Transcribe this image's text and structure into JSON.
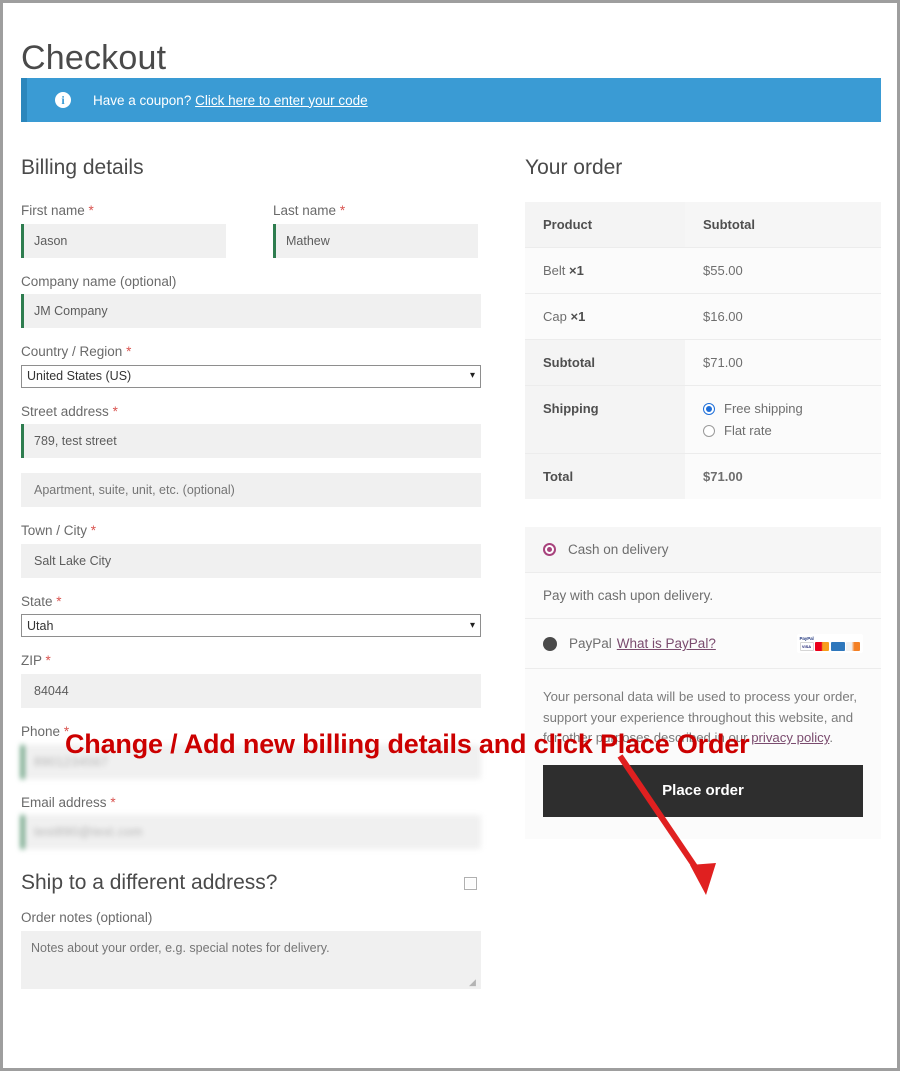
{
  "page": {
    "title": "Checkout"
  },
  "coupon": {
    "icon": "info-icon",
    "text": "Have a coupon?",
    "link_label": "Click here to enter your code"
  },
  "billing": {
    "section_title": "Billing details",
    "required_mark": "*",
    "fields": [
      {
        "name": "first-name",
        "label": "First name",
        "required": true,
        "value": "Jason",
        "type": "text"
      },
      {
        "name": "last-name",
        "label": "Last name",
        "required": true,
        "value": "Mathew",
        "type": "text"
      },
      {
        "name": "company-name",
        "label": "Company name (optional)",
        "required": false,
        "value": "JM Company",
        "type": "text"
      },
      {
        "name": "country",
        "label": "Country / Region",
        "required": true,
        "value": "United States (US)",
        "type": "select"
      },
      {
        "name": "street-address",
        "label": "Street address",
        "required": true,
        "value": "789, test street",
        "type": "text"
      },
      {
        "name": "address-line-2",
        "label": "",
        "required": false,
        "value": "",
        "placeholder": "Apartment, suite, unit, etc. (optional)",
        "type": "text"
      },
      {
        "name": "town-city",
        "label": "Town / City",
        "required": true,
        "value": "Salt Lake City",
        "type": "text"
      },
      {
        "name": "state",
        "label": "State",
        "required": true,
        "value": "Utah",
        "type": "select"
      },
      {
        "name": "zip",
        "label": "ZIP",
        "required": true,
        "value": "84044",
        "type": "text"
      },
      {
        "name": "phone",
        "label": "Phone",
        "required": true,
        "value": "8901234567",
        "type": "text",
        "redacted": true
      },
      {
        "name": "email",
        "label": "Email address",
        "required": true,
        "value": "test890@test.com",
        "type": "text",
        "redacted": true
      }
    ]
  },
  "shipping_toggle": {
    "label": "Ship to a different address?",
    "checked": false
  },
  "order_notes": {
    "label": "Order notes (optional)",
    "placeholder": "Notes about your order, e.g. special notes for delivery.",
    "value": ""
  },
  "order": {
    "section_title": "Your order",
    "columns": [
      "Product",
      "Subtotal"
    ],
    "items": [
      {
        "name": "Belt",
        "qty_symbol": "×",
        "qty": "1",
        "subtotal": "$55.00"
      },
      {
        "name": "Cap",
        "qty_symbol": "×",
        "qty": "1",
        "subtotal": "$16.00"
      }
    ],
    "subtotal_label": "Subtotal",
    "subtotal_value": "$71.00",
    "shipping_label": "Shipping",
    "shipping_options": [
      {
        "label": "Free shipping",
        "selected": true
      },
      {
        "label": "Flat rate",
        "selected": false
      }
    ],
    "total_label": "Total",
    "total_value": "$71.00"
  },
  "payment": {
    "methods": [
      {
        "name": "cash-on-delivery",
        "label": "Cash on delivery",
        "selected": true
      },
      {
        "name": "paypal",
        "label": "PayPal",
        "link_label": "What is PayPal?",
        "selected": false
      }
    ],
    "cod_description": "Pay with cash upon delivery.",
    "paypal_mark": "PayPal",
    "cards": [
      "VISA",
      "mastercard",
      "amex",
      "discover"
    ]
  },
  "privacy": {
    "text": "Your personal data will be used to process your order, support your experience throughout this website, and for other purposes described in our ",
    "link_label": "privacy policy",
    "text_after": "."
  },
  "place_order": {
    "label": "Place order"
  },
  "annotation": {
    "text": "Change / Add new billing details and click Place Order",
    "color": "#cc0000"
  },
  "colors": {
    "coupon_bg": "#3a9bd4",
    "coupon_border": "#2b86bc",
    "valid_field_border": "#2e7d4f",
    "place_order_bg": "#2e2e2e",
    "required_asterisk": "#d9534f",
    "radio_selected": "#1e6fd9",
    "cod_radio": "#a8437d",
    "annotation": "#cc0000"
  }
}
